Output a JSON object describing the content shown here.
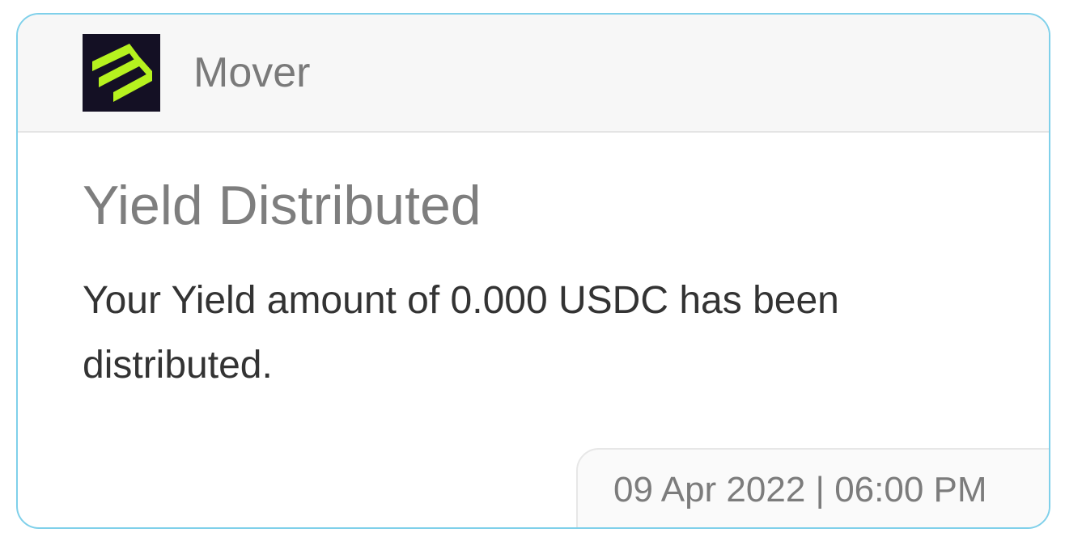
{
  "app": {
    "name": "Mover",
    "logo_icon": "mover-logo-icon",
    "logo_background": "#141024",
    "logo_accent": "#b6f21f"
  },
  "notification": {
    "title": "Yield Distributed",
    "message": "Your Yield amount of 0.000 USDC has been distributed.",
    "timestamp": "09 Apr 2022 | 06:00 PM"
  },
  "colors": {
    "card_border": "#7fd0ea",
    "header_background": "#f7f7f7"
  }
}
